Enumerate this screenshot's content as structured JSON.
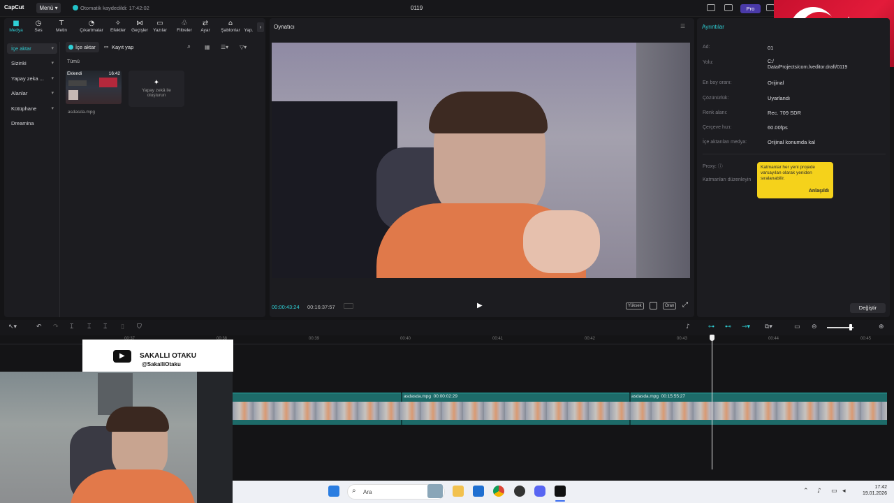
{
  "app": {
    "logo": "CapCut",
    "menu_label": "Menü",
    "autosave": "Otomatik kaydedildi: 17:42:02",
    "project_title": "0119",
    "pro_label": "Pro"
  },
  "toolbar": [
    {
      "label": "Medya",
      "icon": "media-icon"
    },
    {
      "label": "Ses",
      "icon": "audio-icon"
    },
    {
      "label": "Metin",
      "icon": "text-icon"
    },
    {
      "label": "Çıkartmalar",
      "icon": "sticker-icon"
    },
    {
      "label": "Efektler",
      "icon": "effects-icon"
    },
    {
      "label": "Geçişler",
      "icon": "transitions-icon"
    },
    {
      "label": "Yazılar",
      "icon": "captions-icon"
    },
    {
      "label": "Filtreler",
      "icon": "filters-icon"
    },
    {
      "label": "Ayar",
      "icon": "adjust-icon"
    },
    {
      "label": "Şablonlar",
      "icon": "templates-icon"
    },
    {
      "label": "Yap.",
      "icon": "ai-icon"
    }
  ],
  "side_nav": [
    {
      "label": "İçe aktar"
    },
    {
      "label": "Sizinki"
    },
    {
      "label": "Yapay zeka ..."
    },
    {
      "label": "Alanlar"
    },
    {
      "label": "Kütüphane"
    },
    {
      "label": "Dreamina"
    }
  ],
  "media": {
    "import_label": "İçe aktar",
    "record_label": "Kayıt yap",
    "filter_all": "Tümü",
    "thumb_added": "Eklendi",
    "thumb_duration": "16:42",
    "file_name": "asdasda.mpg",
    "ai_create": "Yapay zekâ ile oluşturun"
  },
  "player": {
    "title": "Oynatıcı",
    "current_time": "00:00:43:24",
    "total_time": "00:16:37:57",
    "quality": "Yüksek",
    "ratio": "Oran"
  },
  "details": {
    "title": "Ayrıntılar",
    "rows": [
      {
        "label": "Ad:",
        "value": "01"
      },
      {
        "label": "Yolu:",
        "value": "C:/ Data/Projects/com.lveditor.draft/0119"
      },
      {
        "label": "En boy oranı:",
        "value": "Orijinal"
      },
      {
        "label": "Çözünürlük:",
        "value": "Uyarlandı"
      },
      {
        "label": "Renk alanı:",
        "value": "Rec. 709 SDR"
      },
      {
        "label": "Çerçeve hızı:",
        "value": "60.00fps"
      },
      {
        "label": "İçe aktarılan medya:",
        "value": "Orijinal konumda kal"
      }
    ],
    "proxy_label": "Proxy:",
    "layers_label": "Katmanları düzenleyin",
    "tooltip_text": "Katmanlar her yeni projede varsayılan olarak yeniden sıralanabilir.",
    "tooltip_ok": "Anlaşıldı",
    "change_button": "Değiştir"
  },
  "timeline": {
    "ticks": [
      "00:37",
      "00:38",
      "00:39",
      "00:40",
      "00:41",
      "00:42",
      "00:43",
      "00:44",
      "00:45"
    ],
    "clips": [
      {
        "name": "asdasda.mpg",
        "duration": "00:00:02:29"
      },
      {
        "name": "asdasda.mpg",
        "duration": "00:15:55:27"
      }
    ]
  },
  "overlay": {
    "channel_name": "SAKALLI OTAKU",
    "channel_handle": "@SakalliOtaku"
  },
  "taskbar": {
    "search_placeholder": "Ara",
    "time": "17:42",
    "date": "19.01.2026"
  },
  "colors": {
    "accent": "#2fd0d6",
    "tooltip": "#f5d21b",
    "track": "#1d6b69"
  }
}
